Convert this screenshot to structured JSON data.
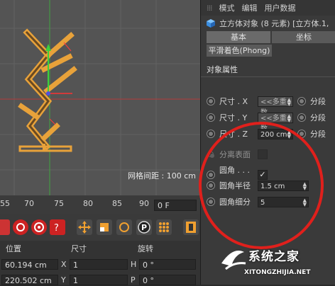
{
  "viewport": {
    "grid_spacing_label": "网格间距 : 100 cm"
  },
  "panel": {
    "menu": [
      "模式",
      "编辑",
      "用户数据"
    ],
    "object_title": "立方体对象 (8 元素) [立方体.1,",
    "tabs": [
      "基本",
      "坐标"
    ],
    "tab_row2": "平滑着色(Phong)",
    "section_title": "对象属性",
    "size_x_label": "尺寸 . X",
    "size_x_value": "<<多重数",
    "size_y_label": "尺寸 . Y",
    "size_y_value": "<<多重数",
    "size_z_label": "尺寸 . Z",
    "size_z_value": "200 cm",
    "segment_label": "分段",
    "separate_surfaces_label": "分离表面",
    "fillet_label": "圆角 . . . .",
    "fillet_checked": "✓",
    "fillet_radius_label": "圆角半径",
    "fillet_radius_value": "1.5 cm",
    "fillet_subdiv_label": "圆角细分",
    "fillet_subdiv_value": "5"
  },
  "timeline": {
    "ticks": [
      "55",
      "70",
      "75",
      "80",
      "85",
      "90"
    ],
    "frame_value": "0 F"
  },
  "coords": {
    "headers": [
      "位置",
      "尺寸",
      "旋转"
    ],
    "pos_x": "60.194 cm",
    "pos_y": "220.502 cm",
    "axis_x": "X",
    "axis_y": "Y",
    "size_x": "1",
    "size_y": "1",
    "rot_h_label": "H",
    "rot_p_label": "P",
    "rot_h": "0 °",
    "rot_p": "0 °"
  },
  "watermark": {
    "title": "系统之家",
    "url": "XITONGZHIJIA.NET"
  },
  "colors": {
    "annotation_circle": "#e0201c",
    "object_orange": "#e8a23a"
  }
}
